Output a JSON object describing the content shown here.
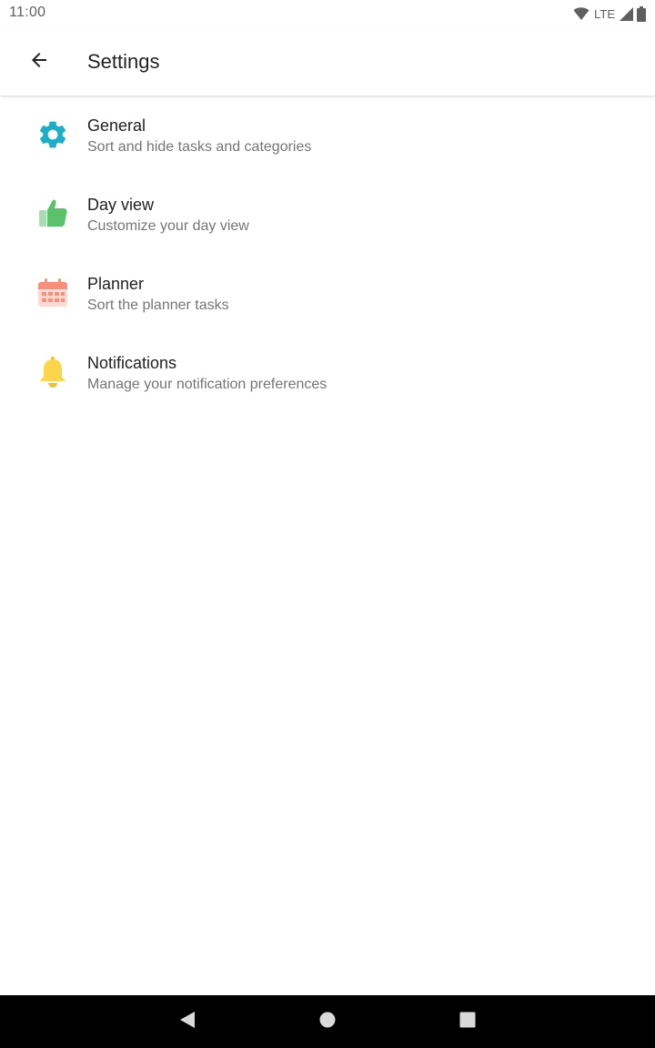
{
  "status_bar": {
    "time": "11:00",
    "network_label": "LTE",
    "icons": [
      "wifi-icon",
      "cell-signal-icon",
      "battery-icon"
    ]
  },
  "app_bar": {
    "back_icon": "arrow-back-icon",
    "title": "Settings"
  },
  "settings": {
    "items": [
      {
        "icon": "gear-icon",
        "icon_color": "#1BAFC7",
        "title": "General",
        "subtitle": "Sort and hide tasks and categories"
      },
      {
        "icon": "thumbs-up-icon",
        "icon_color": "#5CC16B",
        "title": "Day view",
        "subtitle": "Customize your day view"
      },
      {
        "icon": "calendar-icon",
        "icon_color": "#F7907A",
        "title": "Planner",
        "subtitle": "Sort the planner tasks"
      },
      {
        "icon": "bell-icon",
        "icon_color": "#FBD54A",
        "title": "Notifications",
        "subtitle": "Manage your notification preferences"
      }
    ]
  },
  "nav_bar": {
    "buttons": [
      "back-triangle-icon",
      "home-circle-icon",
      "recents-square-icon"
    ]
  }
}
